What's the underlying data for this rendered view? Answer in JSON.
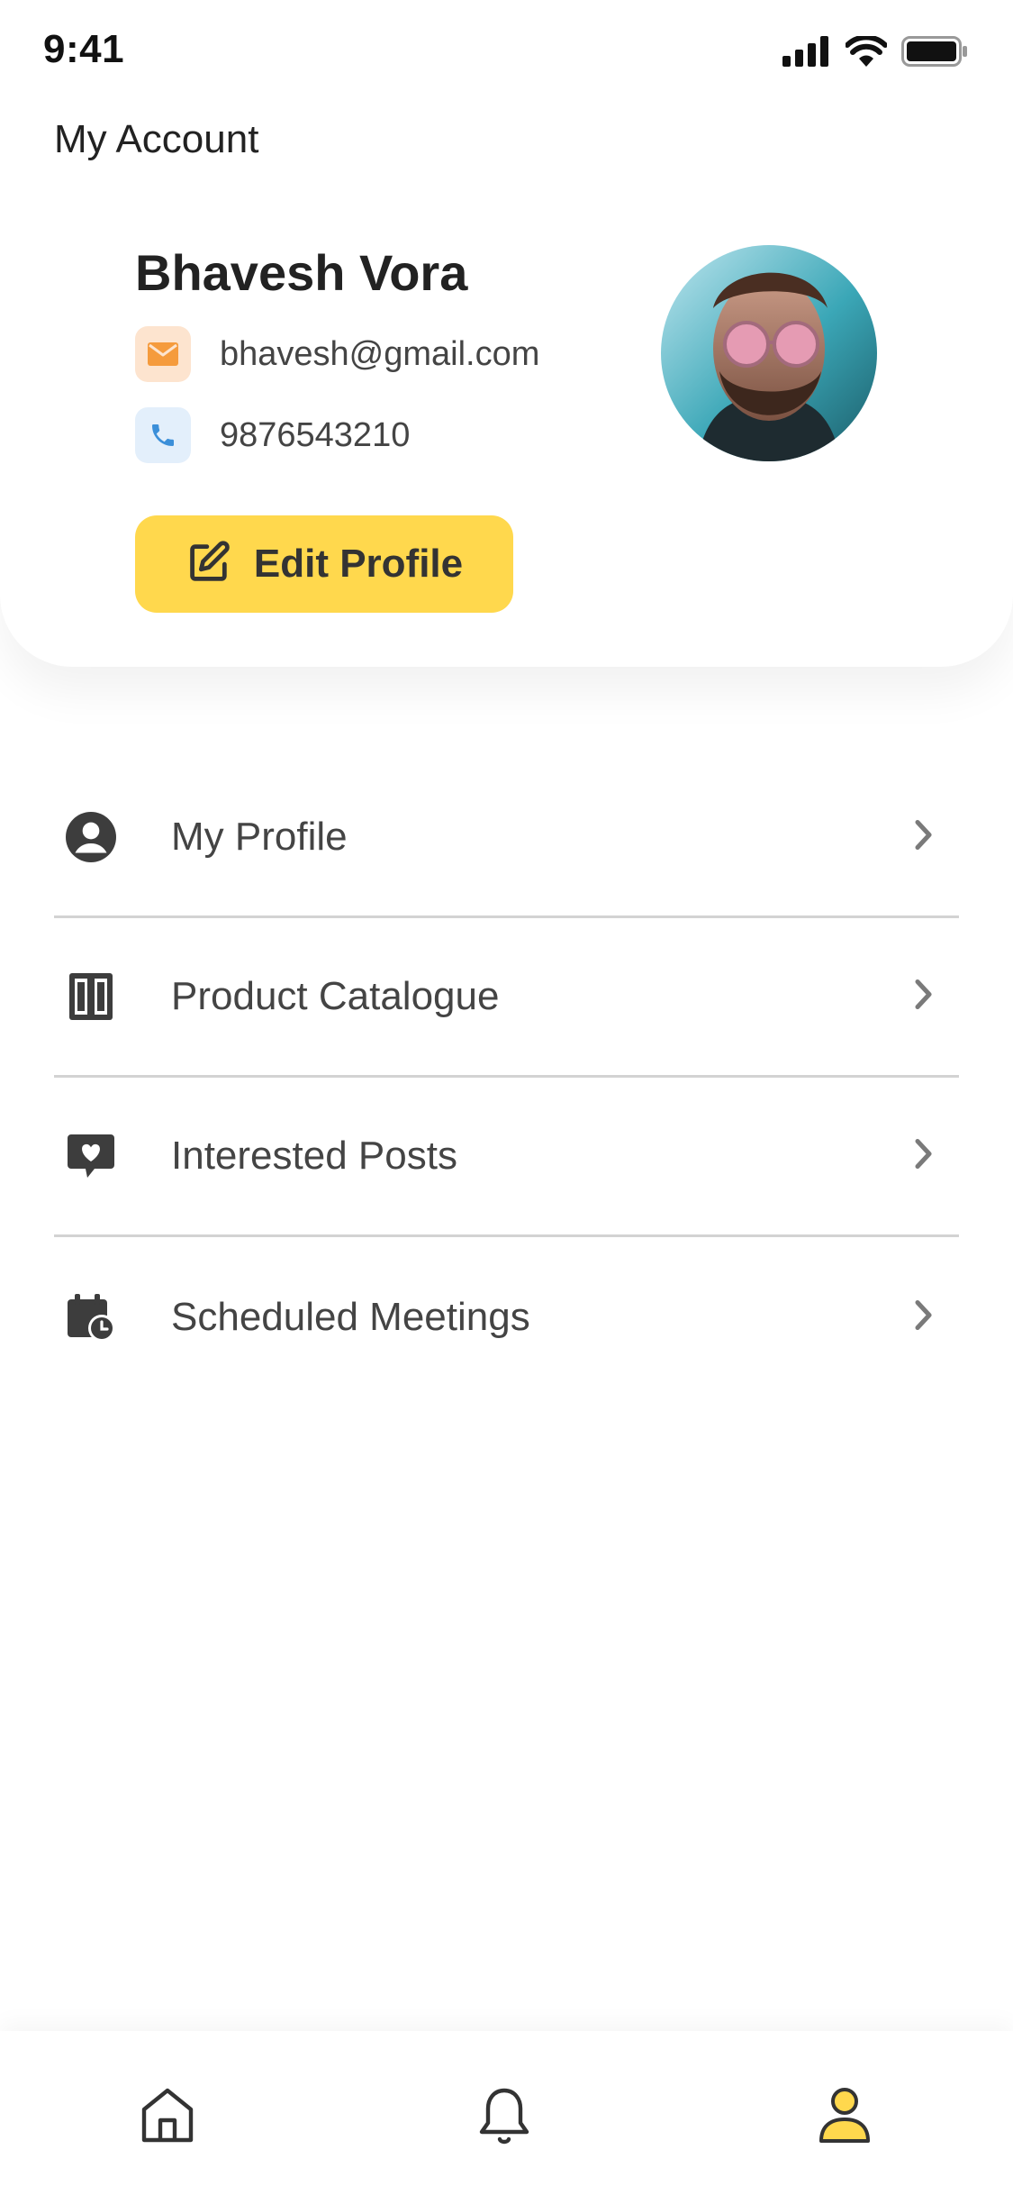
{
  "status_bar": {
    "time": "9:41"
  },
  "header": {
    "title": "My Account"
  },
  "profile": {
    "name": "Bhavesh Vora",
    "email": "bhavesh@gmail.com",
    "phone": "9876543210",
    "edit_button_label": "Edit Profile"
  },
  "menu": {
    "items": [
      {
        "label": "My Profile",
        "icon": "user-circle-icon"
      },
      {
        "label": "Product Catalogue",
        "icon": "catalogue-icon"
      },
      {
        "label": "Interested Posts",
        "icon": "heart-message-icon"
      },
      {
        "label": "Scheduled Meetings",
        "icon": "calendar-clock-icon"
      }
    ]
  },
  "bottom_nav": {
    "items": [
      {
        "icon": "home-icon",
        "active": false
      },
      {
        "icon": "bell-icon",
        "active": false
      },
      {
        "icon": "user-icon",
        "active": true
      }
    ]
  },
  "colors": {
    "accent": "#ffd84d",
    "active_nav": "#ffd84d",
    "email_icon": "#f59b3d",
    "phone_icon": "#3b8fd9",
    "text_primary": "#222222",
    "text_secondary": "#444444",
    "divider": "#d3d3d3"
  }
}
